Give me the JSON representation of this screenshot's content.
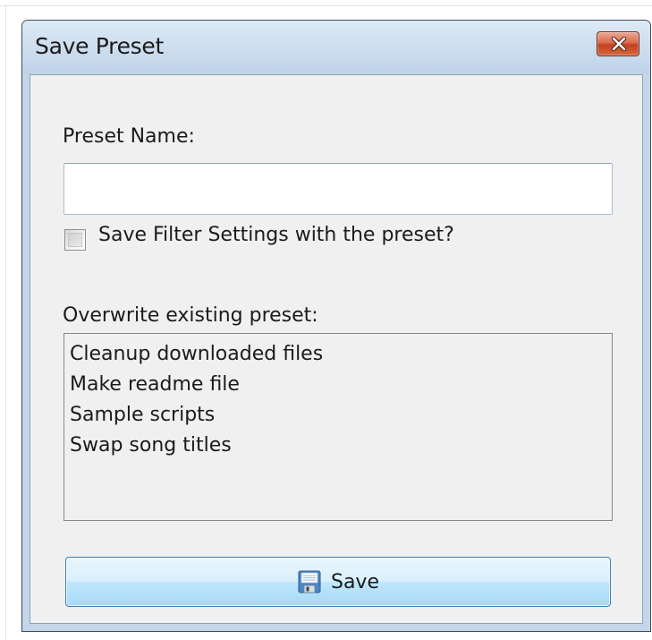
{
  "window": {
    "title": "Save Preset"
  },
  "form": {
    "preset_name_label": "Preset Name:",
    "preset_name_value": "",
    "save_filter_settings_label": "Save Filter Settings with the preset?",
    "save_filter_settings_checked": false,
    "overwrite_label": "Overwrite existing preset:",
    "existing_presets": [
      "Cleanup downloaded files",
      "Make readme file",
      "Sample scripts",
      "Swap song titles"
    ],
    "save_button_label": "Save"
  },
  "icons": {
    "close": "close-icon",
    "save": "floppy-disk-icon"
  },
  "colors": {
    "titlebar": "#cfdfef",
    "client_background": "#f0f0f0",
    "close_button": "#c2401f",
    "save_button": "#bee6fd"
  }
}
